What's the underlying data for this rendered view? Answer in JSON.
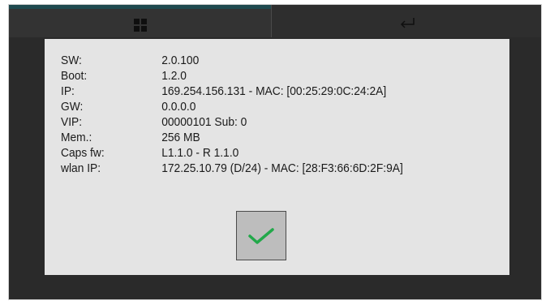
{
  "top_nav": {
    "left_tab_icon": "grid-icon",
    "right_tab_icon": "return-arrow-icon"
  },
  "info_dialog": {
    "rows": [
      {
        "label": "SW:",
        "value": "2.0.100"
      },
      {
        "label": "Boot:",
        "value": "1.2.0"
      },
      {
        "label": "IP:",
        "value": "169.254.156.131 - MAC: [00:25:29:0C:24:2A]"
      },
      {
        "label": "GW:",
        "value": "0.0.0.0"
      },
      {
        "label": "VIP:",
        "value": "00000101 Sub: 0"
      },
      {
        "label": "Mem.:",
        "value": "256 MB"
      },
      {
        "label": "Caps fw:",
        "value": "L1.1.0 - R 1.1.0"
      },
      {
        "label": "wlan IP:",
        "value": "172.25.10.79 (D/24) - MAC: [28:F3:66:6D:2F:9A]"
      }
    ],
    "confirm_icon": "checkmark-icon"
  },
  "colors": {
    "background": "#2a2a2a",
    "dialog": "#e4e4e4",
    "accent_bar": "#1f4a4f",
    "check": "#22a84a",
    "button": "#bdbdbd"
  }
}
